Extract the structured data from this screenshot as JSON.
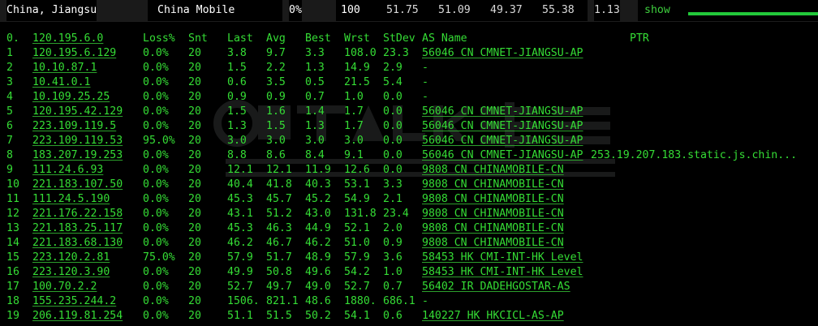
{
  "header": {
    "location": "China, Jiangsu",
    "isp": "China Mobile",
    "loss": "0%",
    "count": "100",
    "last": "51.75",
    "avg": "51.09",
    "best": "49.37",
    "worst": "55.38",
    "stdev": "1.13",
    "show_label": "show"
  },
  "columns": {
    "idx": "0.",
    "host": "120.195.6.0",
    "loss": "Loss%",
    "snt": "Snt",
    "last": "Last",
    "avg": "Avg",
    "best": "Best",
    "wrst": "Wrst",
    "stdev": "StDev",
    "as": "AS Name",
    "ptr": "PTR"
  },
  "rows": [
    {
      "idx": "1",
      "host": "120.195.6.129",
      "loss": "0.0%",
      "snt": "20",
      "last": "3.8",
      "avg": "9.7",
      "best": "3.3",
      "wrst": "108.0",
      "stdev": "23.3",
      "as": "56046 CN CMNET-JIANGSU-AP",
      "ptr": ""
    },
    {
      "idx": "2",
      "host": "10.10.87.1",
      "loss": "0.0%",
      "snt": "20",
      "last": "1.5",
      "avg": "2.2",
      "best": "1.3",
      "wrst": "14.9",
      "stdev": "2.9",
      "as": "-",
      "ptr": ""
    },
    {
      "idx": "3",
      "host": "10.41.0.1",
      "loss": "0.0%",
      "snt": "20",
      "last": "0.6",
      "avg": "3.5",
      "best": "0.5",
      "wrst": "21.5",
      "stdev": "5.4",
      "as": "-",
      "ptr": ""
    },
    {
      "idx": "4",
      "host": "10.109.25.25",
      "loss": "0.0%",
      "snt": "20",
      "last": "0.9",
      "avg": "0.9",
      "best": "0.7",
      "wrst": "1.0",
      "stdev": "0.0",
      "as": "-",
      "ptr": ""
    },
    {
      "idx": "5",
      "host": "120.195.42.129",
      "loss": "0.0%",
      "snt": "20",
      "last": "1.5",
      "avg": "1.6",
      "best": "1.4",
      "wrst": "1.7",
      "stdev": "0.0",
      "as": "56046 CN CMNET-JIANGSU-AP",
      "ptr": ""
    },
    {
      "idx": "6",
      "host": "223.109.119.5",
      "loss": "0.0%",
      "snt": "20",
      "last": "1.3",
      "avg": "1.5",
      "best": "1.3",
      "wrst": "1.7",
      "stdev": "0.0",
      "as": "56046 CN CMNET-JIANGSU-AP",
      "ptr": ""
    },
    {
      "idx": "7",
      "host": "223.109.119.53",
      "loss": "95.0%",
      "snt": "20",
      "last": "3.0",
      "avg": "3.0",
      "best": "3.0",
      "wrst": "3.0",
      "stdev": "0.0",
      "as": "56046 CN CMNET-JIANGSU-AP",
      "ptr": ""
    },
    {
      "idx": "8",
      "host": "183.207.19.253",
      "loss": "0.0%",
      "snt": "20",
      "last": "8.8",
      "avg": "8.6",
      "best": "8.4",
      "wrst": "9.1",
      "stdev": "0.0",
      "as": "56046 CN CMNET-JIANGSU-AP",
      "ptr": "253.19.207.183.static.js.chin..."
    },
    {
      "idx": "9",
      "host": "111.24.6.93",
      "loss": "0.0%",
      "snt": "20",
      "last": "12.1",
      "avg": "12.1",
      "best": "11.9",
      "wrst": "12.6",
      "stdev": "0.0",
      "as": "9808 CN CHINAMOBILE-CN",
      "ptr": ""
    },
    {
      "idx": "10",
      "host": "221.183.107.50",
      "loss": "0.0%",
      "snt": "20",
      "last": "40.4",
      "avg": "41.8",
      "best": "40.3",
      "wrst": "53.1",
      "stdev": "3.3",
      "as": "9808 CN CHINAMOBILE-CN",
      "ptr": ""
    },
    {
      "idx": "11",
      "host": "111.24.5.190",
      "loss": "0.0%",
      "snt": "20",
      "last": "45.3",
      "avg": "45.7",
      "best": "45.2",
      "wrst": "54.9",
      "stdev": "2.1",
      "as": "9808 CN CHINAMOBILE-CN",
      "ptr": ""
    },
    {
      "idx": "12",
      "host": "221.176.22.158",
      "loss": "0.0%",
      "snt": "20",
      "last": "43.1",
      "avg": "51.2",
      "best": "43.0",
      "wrst": "131.8",
      "stdev": "23.4",
      "as": "9808 CN CHINAMOBILE-CN",
      "ptr": ""
    },
    {
      "idx": "13",
      "host": "221.183.25.117",
      "loss": "0.0%",
      "snt": "20",
      "last": "45.3",
      "avg": "46.3",
      "best": "44.9",
      "wrst": "52.1",
      "stdev": "2.0",
      "as": "9808 CN CHINAMOBILE-CN",
      "ptr": ""
    },
    {
      "idx": "14",
      "host": "221.183.68.130",
      "loss": "0.0%",
      "snt": "20",
      "last": "46.2",
      "avg": "46.7",
      "best": "46.2",
      "wrst": "51.0",
      "stdev": "0.9",
      "as": "9808 CN CHINAMOBILE-CN",
      "ptr": ""
    },
    {
      "idx": "15",
      "host": "223.120.2.81",
      "loss": "75.0%",
      "snt": "20",
      "last": "57.9",
      "avg": "51.7",
      "best": "48.9",
      "wrst": "57.9",
      "stdev": "3.6",
      "as": "58453 HK CMI-INT-HK Level",
      "ptr": ""
    },
    {
      "idx": "16",
      "host": "223.120.3.90",
      "loss": "0.0%",
      "snt": "20",
      "last": "49.9",
      "avg": "50.8",
      "best": "49.6",
      "wrst": "54.2",
      "stdev": "1.0",
      "as": "58453 HK CMI-INT-HK Level",
      "ptr": ""
    },
    {
      "idx": "17",
      "host": "100.70.2.2",
      "loss": "0.0%",
      "snt": "20",
      "last": "52.7",
      "avg": "49.7",
      "best": "49.0",
      "wrst": "52.7",
      "stdev": "0.7",
      "as": "56402 IR DADEHGOSTAR-AS",
      "ptr": ""
    },
    {
      "idx": "18",
      "host": "155.235.244.2",
      "loss": "0.0%",
      "snt": "20",
      "last": "1506.",
      "avg": "821.1",
      "best": "48.6",
      "wrst": "1880.",
      "stdev": "686.1",
      "as": "-",
      "ptr": ""
    },
    {
      "idx": "19",
      "host": "206.119.81.254",
      "loss": "0.0%",
      "snt": "20",
      "last": "51.1",
      "avg": "51.5",
      "best": "50.2",
      "wrst": "54.1",
      "stdev": "0.6",
      "as": "140227 HK HKCICL-AS-AP",
      "ptr": ""
    }
  ],
  "watermark": {
    "brand": "SeTALK 主机说",
    "site": "www.idcsmart.com",
    "tagline": "全球领先的云计算平台"
  },
  "colors": {
    "background": "#000000",
    "text_green": "#35dd35",
    "bar_green": "#22c93a",
    "header_white": "#ffffff"
  }
}
